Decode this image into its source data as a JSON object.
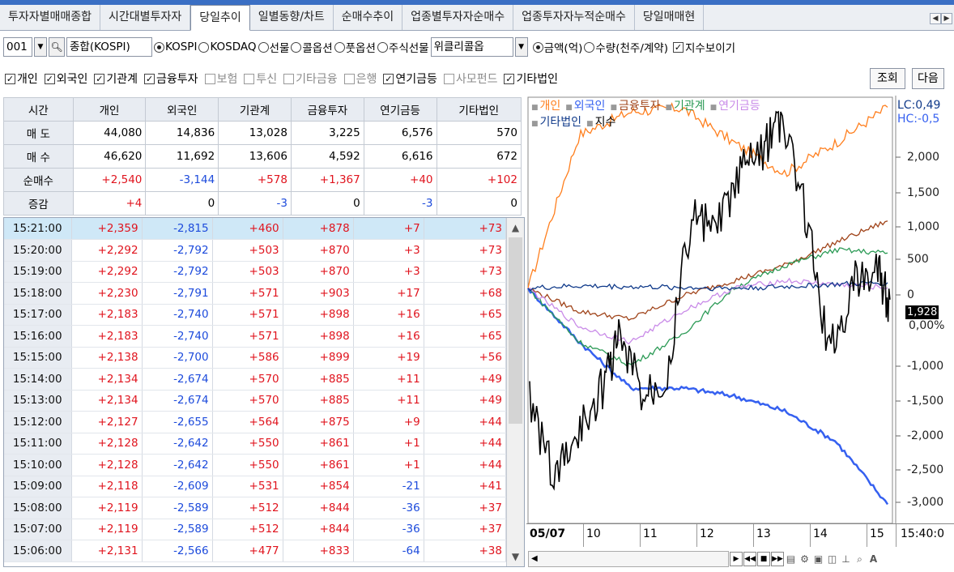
{
  "tabs": [
    "투자자별매매종합",
    "시간대별투자자",
    "당일추이",
    "일별동향/차트",
    "순매수추이",
    "업종별투자자순매수",
    "업종투자자누적순매수",
    "당일매매현"
  ],
  "active_tab": 2,
  "toolbar": {
    "code": "001",
    "search_icon": "search-icon",
    "market_name": "종합(KOSPI)",
    "radio_market": [
      "KOSPI",
      "KOSDAQ",
      "선물",
      "콜옵션",
      "풋옵션",
      "주식선물"
    ],
    "weekly_option": "위클리콜옵",
    "radio_unit": [
      "금액(억)",
      "수량(천주/계약)"
    ],
    "show_index_label": "지수보이기",
    "investors": [
      "개인",
      "외국인",
      "기관계",
      "금융투자",
      "보험",
      "투신",
      "기타금융",
      "은행",
      "연기금등",
      "사모펀드",
      "기타법인"
    ],
    "investors_checked": [
      true,
      true,
      true,
      true,
      false,
      false,
      false,
      false,
      true,
      false,
      true
    ],
    "query_button": "조회",
    "next_button": "다음"
  },
  "summary": {
    "headers": [
      "시간",
      "개인",
      "외국인",
      "기관계",
      "금융투자",
      "연기금등",
      "기타법인"
    ],
    "rows": [
      {
        "label": "매 도",
        "values": [
          "44,080",
          "14,836",
          "13,028",
          "3,225",
          "6,576",
          "570"
        ]
      },
      {
        "label": "매 수",
        "values": [
          "46,620",
          "11,692",
          "13,606",
          "4,592",
          "6,616",
          "672"
        ]
      },
      {
        "label": "순매수",
        "values": [
          "+2,540",
          "-3,144",
          "+578",
          "+1,367",
          "+40",
          "+102"
        ]
      },
      {
        "label": "증감",
        "values": [
          "+4",
          "0",
          "-3",
          "0",
          "-3",
          "0"
        ]
      }
    ]
  },
  "detail_rows": [
    [
      "15:21:00",
      "+2,359",
      "-2,815",
      "+460",
      "+878",
      "+7",
      "+73"
    ],
    [
      "15:20:00",
      "+2,292",
      "-2,792",
      "+503",
      "+870",
      "+3",
      "+73"
    ],
    [
      "15:19:00",
      "+2,292",
      "-2,792",
      "+503",
      "+870",
      "+3",
      "+73"
    ],
    [
      "15:18:00",
      "+2,230",
      "-2,791",
      "+571",
      "+903",
      "+17",
      "+68"
    ],
    [
      "15:17:00",
      "+2,183",
      "-2,740",
      "+571",
      "+898",
      "+16",
      "+65"
    ],
    [
      "15:16:00",
      "+2,183",
      "-2,740",
      "+571",
      "+898",
      "+16",
      "+65"
    ],
    [
      "15:15:00",
      "+2,138",
      "-2,700",
      "+586",
      "+899",
      "+19",
      "+56"
    ],
    [
      "15:14:00",
      "+2,134",
      "-2,674",
      "+570",
      "+885",
      "+11",
      "+49"
    ],
    [
      "15:13:00",
      "+2,134",
      "-2,674",
      "+570",
      "+885",
      "+11",
      "+49"
    ],
    [
      "15:12:00",
      "+2,127",
      "-2,655",
      "+564",
      "+875",
      "+9",
      "+44"
    ],
    [
      "15:11:00",
      "+2,128",
      "-2,642",
      "+550",
      "+861",
      "+1",
      "+44"
    ],
    [
      "15:10:00",
      "+2,128",
      "-2,642",
      "+550",
      "+861",
      "+1",
      "+44"
    ],
    [
      "15:09:00",
      "+2,118",
      "-2,609",
      "+531",
      "+854",
      "-21",
      "+41"
    ],
    [
      "15:08:00",
      "+2,119",
      "-2,589",
      "+512",
      "+844",
      "-36",
      "+37"
    ],
    [
      "15:07:00",
      "+2,119",
      "-2,589",
      "+512",
      "+844",
      "-36",
      "+37"
    ],
    [
      "15:06:00",
      "+2,131",
      "-2,566",
      "+477",
      "+833",
      "-64",
      "+38"
    ]
  ],
  "chart": {
    "legend": [
      {
        "name": "개인",
        "color": "#ff7f1e"
      },
      {
        "name": "외국인",
        "color": "#3560f0"
      },
      {
        "name": "금융투자",
        "color": "#a0441a"
      },
      {
        "name": "기관계",
        "color": "#2b9a55"
      },
      {
        "name": "연기금등",
        "color": "#c98be8"
      },
      {
        "name": "기타법인",
        "color": "#103a8a"
      },
      {
        "name": "지수",
        "color": "#000000"
      }
    ],
    "lc": "LC:0,49",
    "hc": "HC:-0,5",
    "yticks": [
      "2,000",
      "1,500",
      "1,000",
      "500",
      "0",
      "-1,000",
      "-1,500",
      "-2,000",
      "-2,500",
      "-3,000"
    ],
    "current_price": "1,928",
    "current_pct": "0,00%",
    "x_first": "05/07",
    "x_labels": [
      "10",
      "11",
      "12",
      "13",
      "14",
      "15"
    ],
    "x_time": "15:40:0"
  },
  "chart_data": {
    "type": "line",
    "x": [
      "09:00",
      "10:00",
      "11:00",
      "12:00",
      "13:00",
      "14:00",
      "15:00",
      "15:21"
    ],
    "series": [
      {
        "name": "개인",
        "values": [
          0,
          2000,
          2300,
          2350,
          1900,
          1500,
          1900,
          2359
        ]
      },
      {
        "name": "외국인",
        "values": [
          0,
          -700,
          -1300,
          -1300,
          -1400,
          -1600,
          -2000,
          -2815
        ]
      },
      {
        "name": "금융투자",
        "values": [
          0,
          -300,
          -400,
          -100,
          100,
          300,
          600,
          878
        ]
      },
      {
        "name": "기관계",
        "values": [
          0,
          -700,
          -1000,
          -600,
          0,
          300,
          500,
          460
        ]
      },
      {
        "name": "연기금등",
        "values": [
          0,
          -500,
          -700,
          -300,
          0,
          100,
          50,
          7
        ]
      },
      {
        "name": "기타법인",
        "values": [
          0,
          30,
          20,
          10,
          0,
          20,
          50,
          73
        ]
      }
    ],
    "ylim": [
      -3000,
      2300
    ]
  }
}
